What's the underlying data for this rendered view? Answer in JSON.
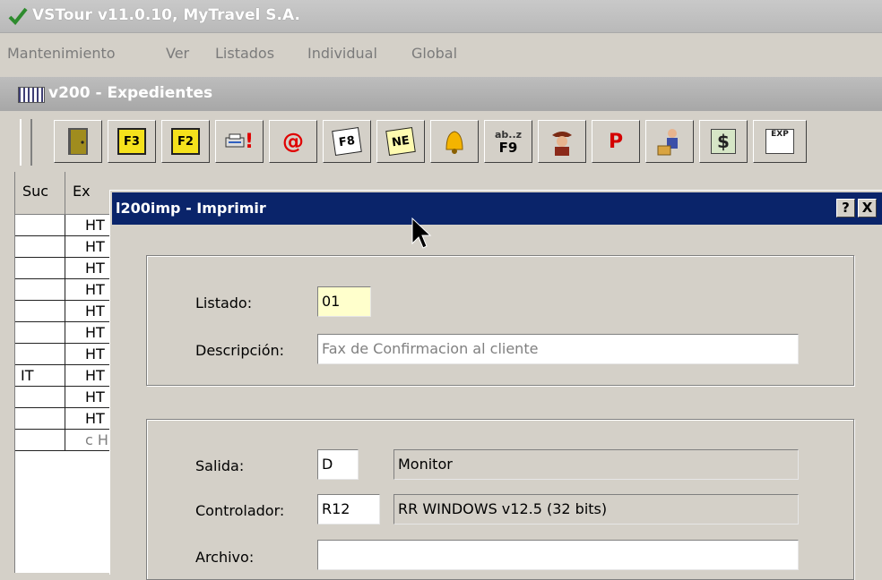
{
  "app": {
    "title": "VSTour v11.0.10, MyTravel S.A.",
    "menu": [
      "Mantenimiento",
      "Ver",
      "Listados",
      "Individual",
      "Global"
    ]
  },
  "child_window": {
    "title": "v200 - Expedientes"
  },
  "toolbar": {
    "buttons": [
      {
        "icon": "door-exit-icon",
        "label": ""
      },
      {
        "icon": "f3-key-icon",
        "label": "F3"
      },
      {
        "icon": "f2-key-icon",
        "label": "F2"
      },
      {
        "icon": "print-alert-icon",
        "label": "!"
      },
      {
        "icon": "email-icon",
        "label": "@"
      },
      {
        "icon": "f8-note-icon",
        "label": "F8"
      },
      {
        "icon": "ne-note-icon",
        "label": "NE"
      },
      {
        "icon": "bell-icon",
        "label": ""
      },
      {
        "icon": "sort-az-f9-icon",
        "label": "F9"
      },
      {
        "icon": "agent-icon",
        "label": ""
      },
      {
        "icon": "parking-doc-icon",
        "label": "P"
      },
      {
        "icon": "person-box-icon",
        "label": ""
      },
      {
        "icon": "money-table-icon",
        "label": "$"
      },
      {
        "icon": "export-chart-icon",
        "label": "EXP"
      }
    ]
  },
  "grid": {
    "headers": [
      "Suc",
      "Ex"
    ],
    "rows": [
      {
        "suc": "",
        "exp": "HT"
      },
      {
        "suc": "",
        "exp": "HT"
      },
      {
        "suc": "",
        "exp": "HT"
      },
      {
        "suc": "",
        "exp": "HT"
      },
      {
        "suc": "",
        "exp": "HT"
      },
      {
        "suc": "",
        "exp": "HT"
      },
      {
        "suc": "",
        "exp": "HT"
      },
      {
        "suc": "IT",
        "exp": "HT"
      },
      {
        "suc": "",
        "exp": "HT"
      },
      {
        "suc": "",
        "exp": "HT"
      },
      {
        "suc": "",
        "exp": "c H"
      }
    ]
  },
  "dialog": {
    "title": "l200imp - Imprimir",
    "help_button": "?",
    "close_button": "X",
    "listado_label": "Listado:",
    "listado_value": "01",
    "descripcion_label": "Descripción:",
    "descripcion_value": "Fax de Confirmacion al cliente",
    "salida_label": "Salida:",
    "salida_code": "D",
    "salida_desc": "Monitor",
    "controlador_label": "Controlador:",
    "controlador_code": "R12",
    "controlador_desc": "RR WINDOWS v12.5 (32 bits)",
    "archivo_label": "Archivo:",
    "archivo_value": ""
  }
}
